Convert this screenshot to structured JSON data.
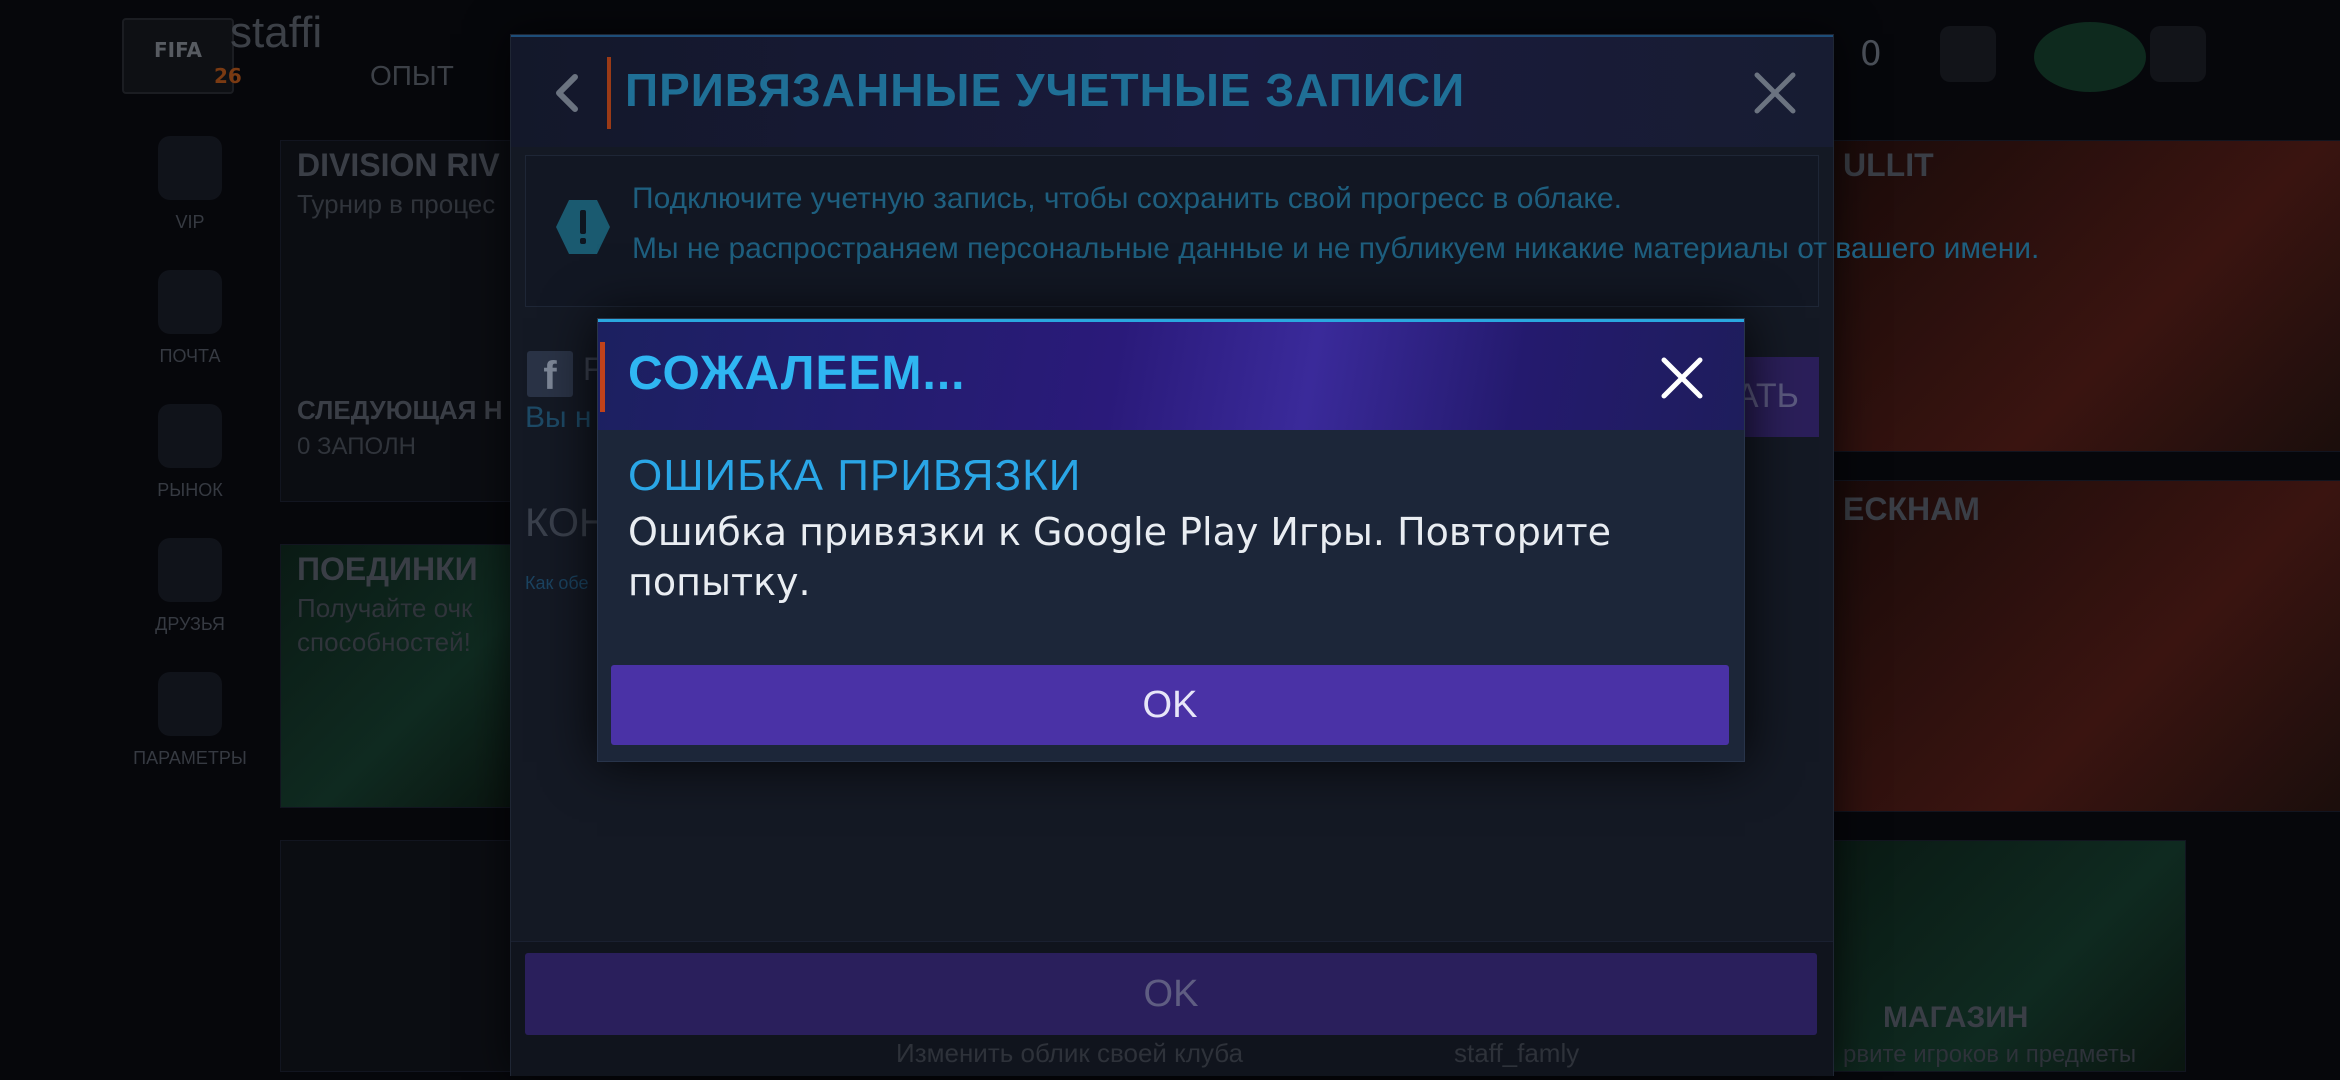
{
  "background": {
    "topbar": {
      "logo_text": "FIFA",
      "level": "26",
      "username": "staffi",
      "xp_label": "ОПЫТ",
      "coins": "0"
    },
    "sidebar": [
      {
        "label": "VIP",
        "icon": "crown-icon"
      },
      {
        "label": "ПОЧТА",
        "icon": "mail-icon"
      },
      {
        "label": "РЫНОК",
        "icon": "gavel-icon"
      },
      {
        "label": "ДРУЗЬЯ",
        "icon": "puzzle-icon"
      },
      {
        "label": "ПАРАМЕТРЫ",
        "icon": "gear-icon"
      }
    ],
    "tiles": {
      "division_title": "DIVISION RIV",
      "division_sub": "Турнир в процес",
      "next_title": "СЛЕДУЮЩАЯ Н",
      "next_value": "0 ЗАПОЛН",
      "duels_title": "ПОЕДИНКИ",
      "duels_sub1": "Получайте очк",
      "duels_sub2": "способностей!",
      "right_title": "ULLIT",
      "right_title2": "ЕСКНАМ",
      "shop_label": "МАГАЗИН",
      "shop_sub": "рвите игроков и предметы",
      "bottom_1": "Изменить облик своей клуба",
      "bottom_2": "staff_famly"
    }
  },
  "linked_accounts_modal": {
    "title": "ПРИВЯЗАННЫЕ УЧЕТНЫЕ ЗАПИСИ",
    "info_line1": "Подключите учетную запись, чтобы сохранить свой прогресс в облаке.",
    "info_line2": "Мы не распространяем персональные данные и не публикуем никакие материалы от вашего имени.",
    "facebook_name": "F",
    "facebook_sub": "Вы н",
    "link_button": "ВАТЬ",
    "console_label": "КОНС",
    "console_link": "Как обе",
    "ok_label": "OK"
  },
  "error_dialog": {
    "title": "СОЖАЛЕЕМ...",
    "heading": "ОШИБКА ПРИВЯЗКИ",
    "message": "Ошибка привязки к Google Play Игры. Повторите попытку.",
    "ok_label": "OK"
  },
  "colors": {
    "accent_blue": "#2fb6f2",
    "ok_button": "#4a32a6",
    "accent_orange": "#c0421a"
  }
}
